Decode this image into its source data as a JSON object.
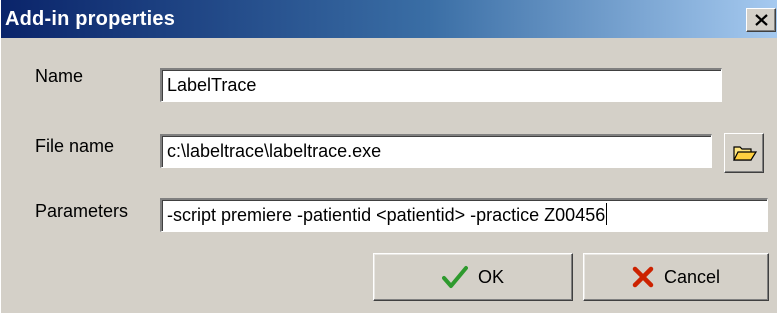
{
  "window": {
    "title": "Add-in properties",
    "close_icon": "close-icon"
  },
  "form": {
    "name_label": "Name",
    "name_value": "LabelTrace",
    "filename_label": "File name",
    "filename_value": "c:\\labeltrace\\labeltrace.exe",
    "browse_icon": "folder-open-icon",
    "parameters_label": "Parameters",
    "parameters_value": "-script premiere -patientid <patientid> -practice Z00456"
  },
  "buttons": {
    "ok_label": "OK",
    "ok_icon": "checkmark-icon",
    "cancel_label": "Cancel",
    "cancel_icon": "red-x-icon"
  },
  "colors": {
    "titlebar_start": "#0a246a",
    "titlebar_end": "#a6caf0",
    "dialog_face": "#d4d0c8",
    "ok_check": "#2e9a2e",
    "cancel_x": "#cc2200"
  }
}
